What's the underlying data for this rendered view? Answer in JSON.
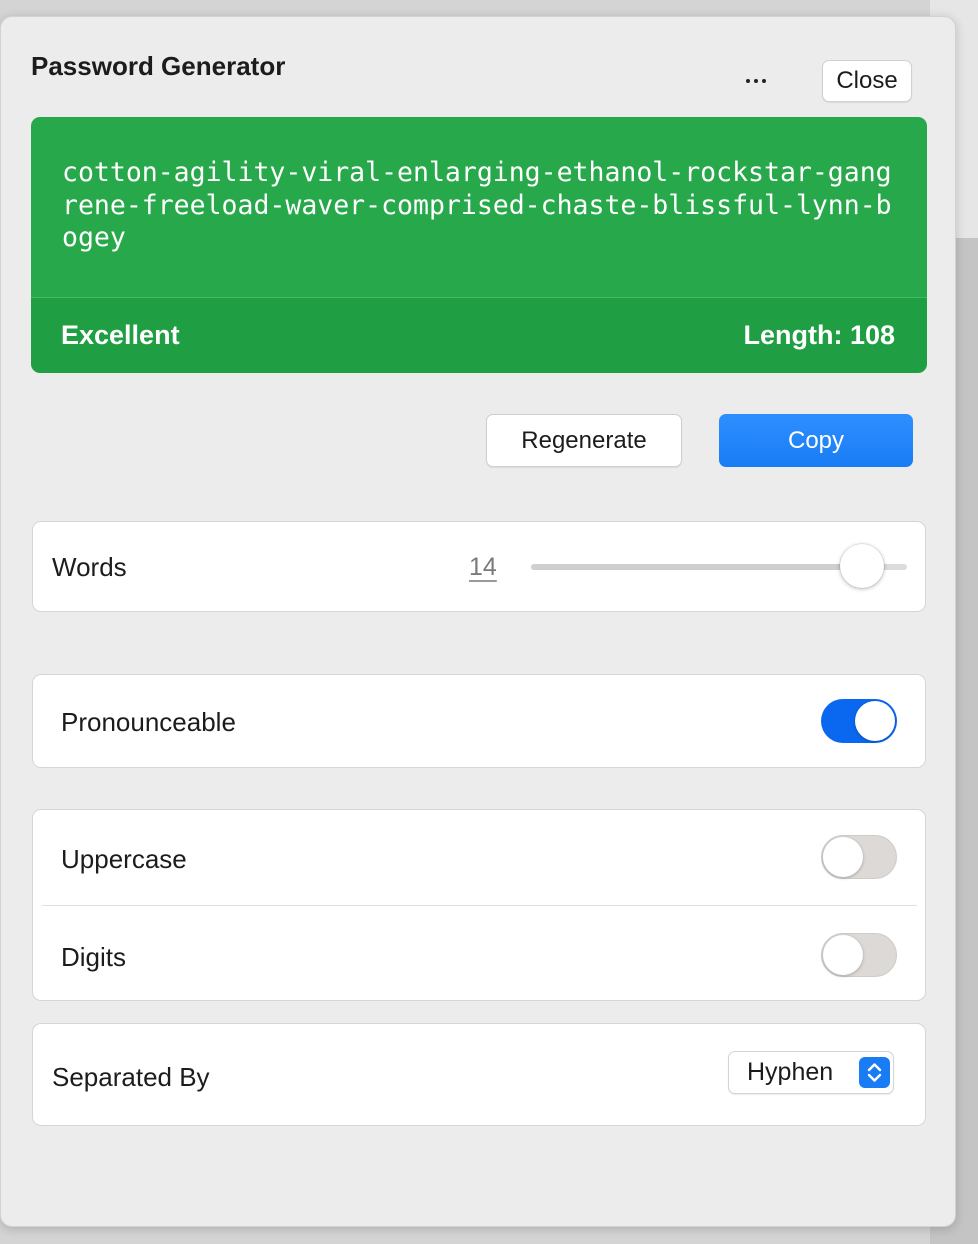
{
  "header": {
    "title": "Password Generator",
    "more_label": "More options",
    "close_label": "Close"
  },
  "password": {
    "value": "cotton-agility-viral-enlarging-ethanol-rockstar-gangrene-freeload-waver-comprised-chaste-blissful-lynn-bogey",
    "strength": "Excellent",
    "length_text": "Length: 108",
    "color": "#27a94b"
  },
  "actions": {
    "regenerate_label": "Regenerate",
    "copy_label": "Copy",
    "accent_color": "#1a7cf5"
  },
  "words": {
    "label": "Words",
    "value": "14",
    "slider_fraction": 0.88
  },
  "options": {
    "pronounceable": {
      "label": "Pronounceable",
      "checked": true
    },
    "uppercase": {
      "label": "Uppercase",
      "checked": false
    },
    "digits": {
      "label": "Digits",
      "checked": false
    }
  },
  "separator": {
    "label": "Separated By",
    "selected": "Hyphen",
    "stepper_icon": "chevron-up-down-icon"
  }
}
